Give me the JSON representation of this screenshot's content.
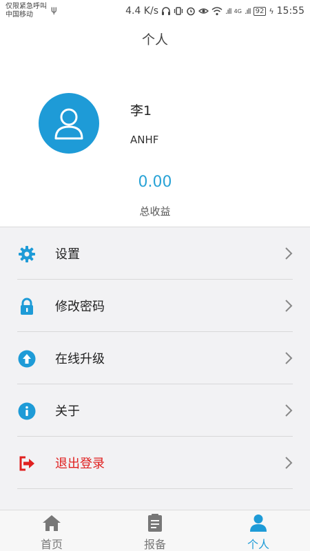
{
  "status_bar": {
    "carrier_line1": "仅限紧急呼叫",
    "carrier_line2": "中国移动",
    "net_speed": "4.4 K/s",
    "network": "4G",
    "battery": "92",
    "time": "15:55"
  },
  "header": {
    "title": "个人"
  },
  "profile": {
    "name": "李1",
    "code": "ANHF",
    "income_value": "0.00",
    "income_label": "总收益"
  },
  "menu": [
    {
      "label": "设置",
      "icon": "gear-icon"
    },
    {
      "label": "修改密码",
      "icon": "lock-icon"
    },
    {
      "label": "在线升级",
      "icon": "upgrade-icon"
    },
    {
      "label": "关于",
      "icon": "info-icon"
    },
    {
      "label": "退出登录",
      "icon": "logout-icon"
    }
  ],
  "bottom_nav": [
    {
      "label": "首页",
      "icon": "home-icon"
    },
    {
      "label": "报备",
      "icon": "clipboard-icon"
    },
    {
      "label": "个人",
      "icon": "person-icon",
      "active": true
    }
  ],
  "colors": {
    "accent": "#1e9bd7",
    "logout": "#e0201f",
    "income": "#29a3d6"
  }
}
